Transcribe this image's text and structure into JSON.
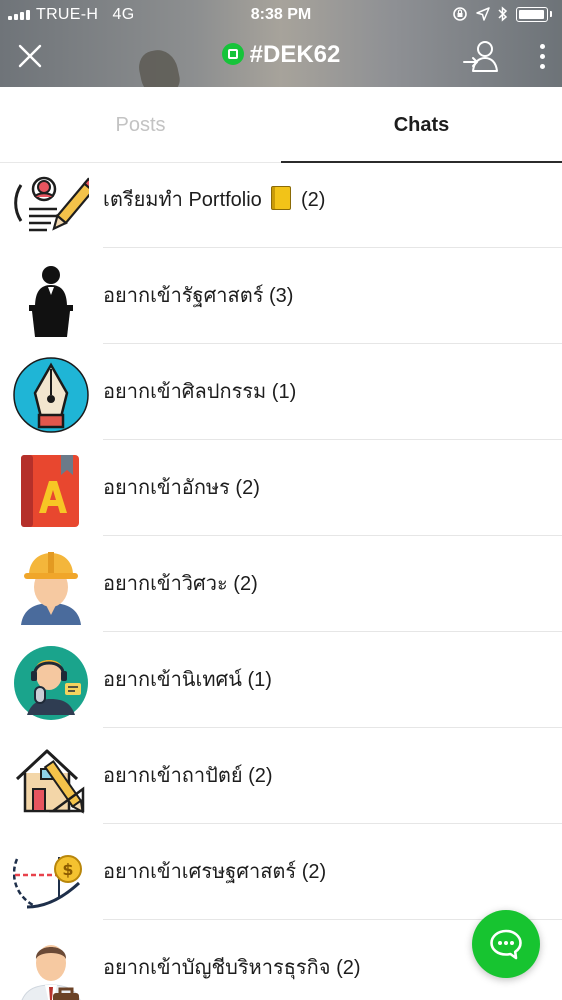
{
  "status_bar": {
    "carrier": "TRUE-H",
    "network": "4G",
    "time": "8:38 PM",
    "icons": [
      "orientation-lock-icon",
      "location-arrow-icon",
      "bluetooth-icon",
      "battery-icon"
    ]
  },
  "header": {
    "title": "#DEK62",
    "close_icon": "close-icon",
    "member_icon": "member-icon",
    "more_icon": "more-vertical-icon"
  },
  "tabs": [
    {
      "label": "Posts",
      "active": false
    },
    {
      "label": "Chats",
      "active": true
    }
  ],
  "chats": [
    {
      "name": "เตรียมทำ Portfolio",
      "emoji": "notebook-icon",
      "count": "(2)",
      "icon": "resume-pencil-icon"
    },
    {
      "name": "อยากเข้ารัฐศาสตร์",
      "count": "(3)",
      "icon": "podium-speaker-icon"
    },
    {
      "name": "อยากเข้าศิลปกรรม",
      "count": "(1)",
      "icon": "pen-nib-icon"
    },
    {
      "name": "อยากเข้าอักษร",
      "count": "(2)",
      "icon": "book-letter-a-icon"
    },
    {
      "name": "อยากเข้าวิศวะ",
      "count": "(2)",
      "icon": "engineer-helmet-icon"
    },
    {
      "name": "อยากเข้านิเทศน์",
      "count": "(1)",
      "icon": "broadcaster-microphone-icon"
    },
    {
      "name": "อยากเข้าถาปัตย์",
      "count": "(2)",
      "icon": "house-design-icon"
    },
    {
      "name": "อยากเข้าเศรษฐศาสตร์",
      "count": "(2)",
      "icon": "economics-coin-icon"
    },
    {
      "name": "อยากเข้าบัญชีบริหารธุรกิจ",
      "count": "(2)",
      "icon": "businessman-briefcase-icon"
    }
  ],
  "fab": {
    "icon": "chat-bubble-icon"
  },
  "colors": {
    "brand_green": "#17c430",
    "active_tab": "#1d1d1d",
    "inactive_tab": "#c3c3c3"
  }
}
